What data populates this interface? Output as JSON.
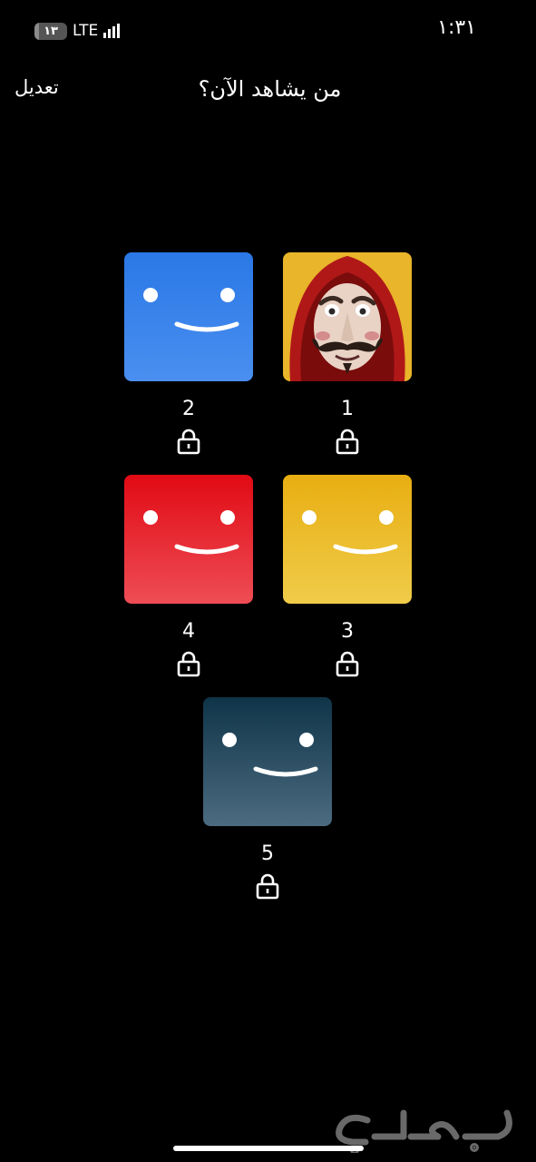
{
  "status_bar": {
    "time": "١:٣١",
    "network": "LTE",
    "battery_text": "١٣",
    "battery_level": 0.13
  },
  "header": {
    "title": "من يشاهد الآن؟",
    "edit_label": "تعديل"
  },
  "profiles": [
    {
      "name": "1",
      "avatar": "money-heist-mask-avatar",
      "locked": true
    },
    {
      "name": "2",
      "avatar": "smiley-blue-avatar",
      "color": "#2f7de8",
      "locked": true
    },
    {
      "name": "3",
      "avatar": "smiley-yellow-avatar",
      "color": "#ebb52a",
      "locked": true
    },
    {
      "name": "4",
      "avatar": "smiley-red-avatar",
      "color": "#e4141d",
      "locked": true
    },
    {
      "name": "5",
      "avatar": "smiley-teal-avatar",
      "color": "#26485d",
      "locked": true
    }
  ],
  "watermark": "حراج"
}
